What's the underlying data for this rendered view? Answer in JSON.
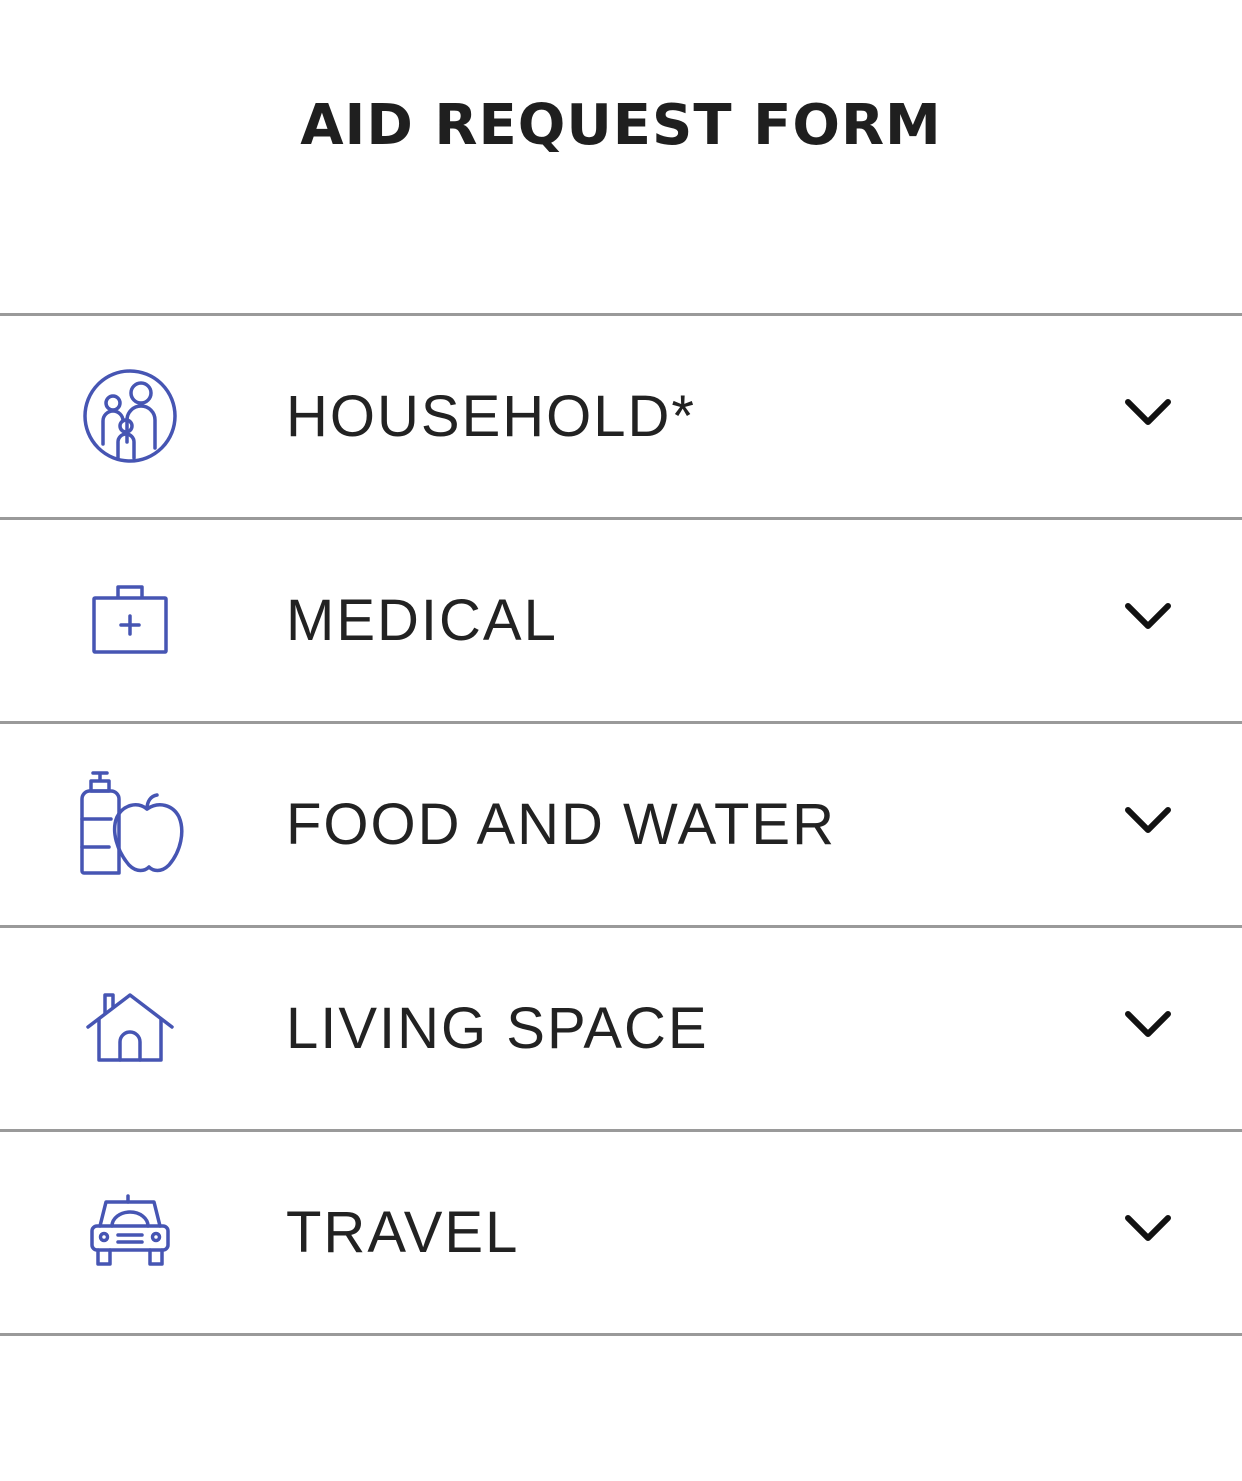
{
  "header": {
    "title": "AID REQUEST FORM"
  },
  "colors": {
    "icon": "#4655b3",
    "divider": "#9a9a9a",
    "text": "#222222"
  },
  "sections": [
    {
      "label": "HOUSEHOLD*",
      "icon": "family-icon"
    },
    {
      "label": "MEDICAL",
      "icon": "first-aid-kit-icon"
    },
    {
      "label": "FOOD AND WATER",
      "icon": "bottle-and-apple-icon"
    },
    {
      "label": "LIVING SPACE",
      "icon": "house-icon"
    },
    {
      "label": "TRAVEL",
      "icon": "car-icon"
    }
  ]
}
